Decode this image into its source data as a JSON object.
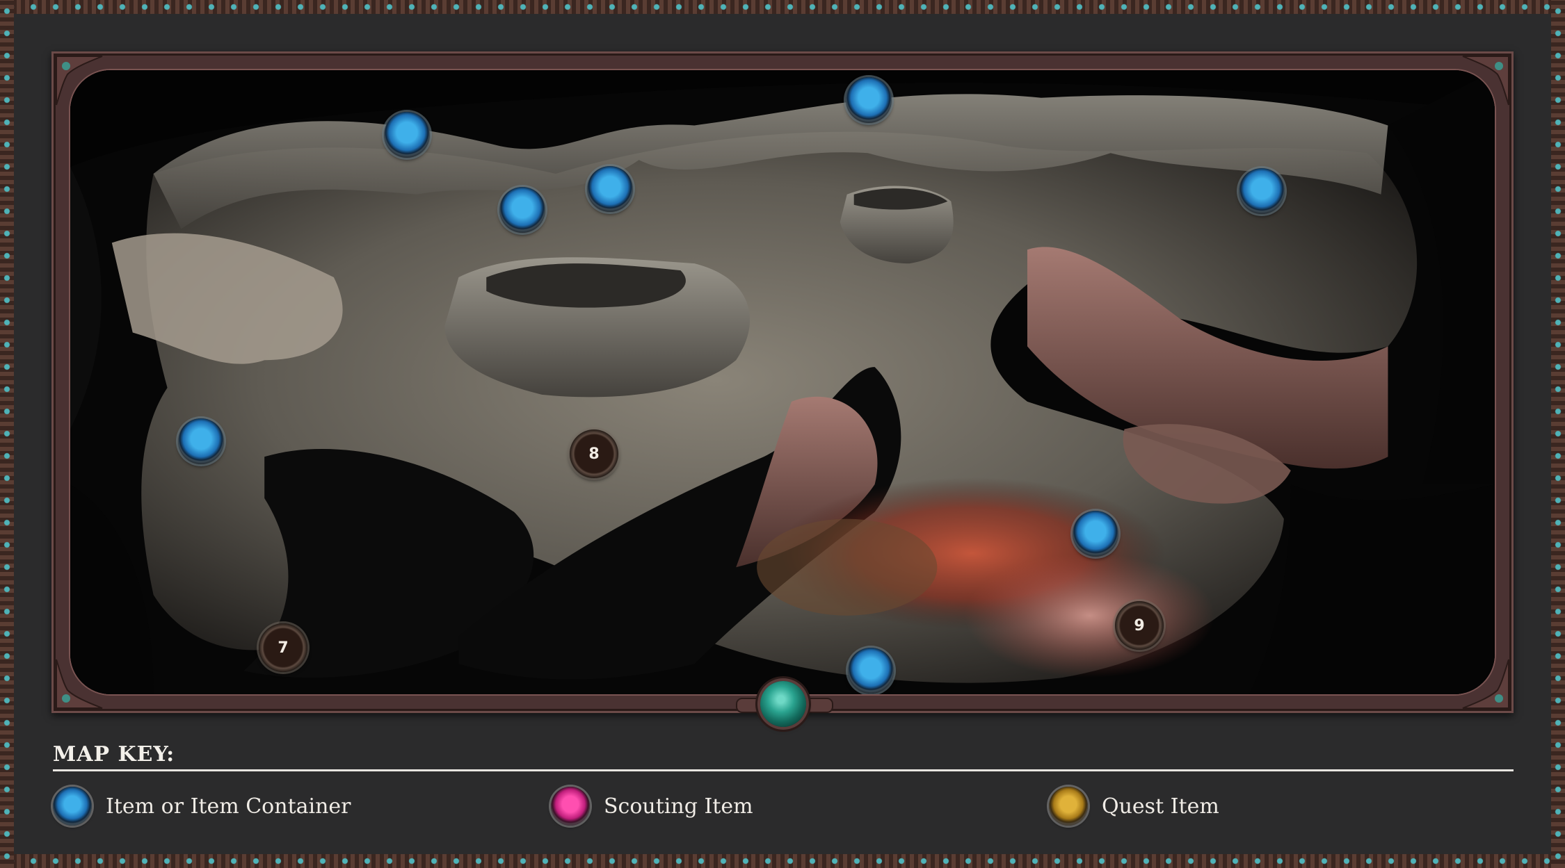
{
  "map": {
    "markers": {
      "m7": "7",
      "m8": "8",
      "m9": "9"
    }
  },
  "map_key": {
    "title": "MAP KEY:",
    "items": [
      {
        "label": "Item or Item Container",
        "icon": "blue-item-marker-icon",
        "color": "#2f8fd8"
      },
      {
        "label": "Scouting Item",
        "icon": "pink-scouting-marker-icon",
        "color": "#e0318f"
      },
      {
        "label": "Quest Item",
        "icon": "gold-quest-marker-icon",
        "color": "#c9961f"
      }
    ]
  },
  "colors": {
    "background": "#2b2b2c",
    "frame": "#4a3232",
    "gem": "#2aa38f",
    "bead": "#4fb3b8"
  }
}
